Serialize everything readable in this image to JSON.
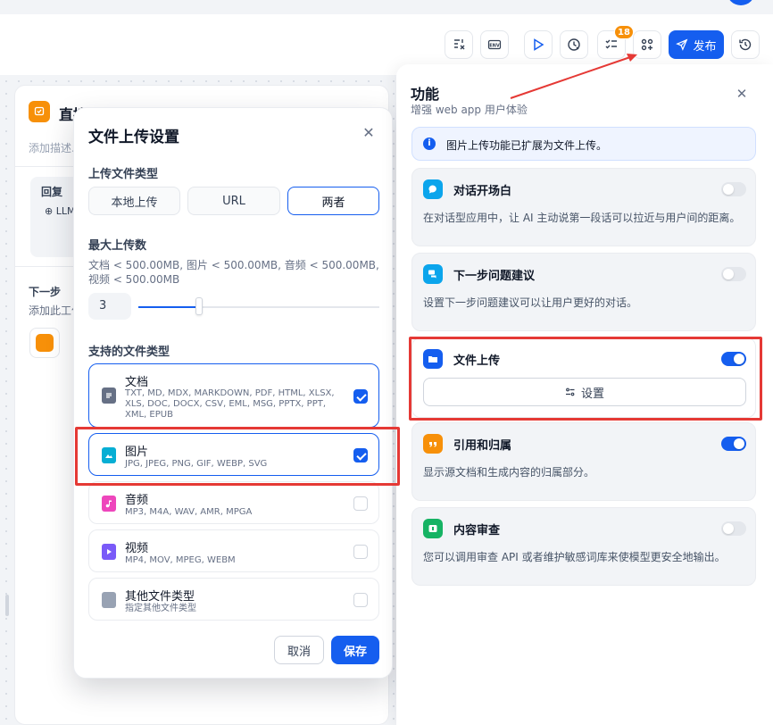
{
  "toolbar": {
    "badge_count": "18",
    "publish_label": "发布",
    "icons": [
      "checklist-x-icon",
      "env-icon",
      "play-icon",
      "history-run-icon",
      "checklist-icon",
      "features-icon",
      "send-icon",
      "history-icon"
    ]
  },
  "background_panel": {
    "title": "直接回复",
    "description": "添加描述...",
    "reply_label": "回复",
    "llm_label": "LLM",
    "next_label": "下一步",
    "next_description": "添加此工作流程中的下一个块"
  },
  "modal": {
    "title": "文件上传设置",
    "upload_type_label": "上传文件类型",
    "upload_types": [
      "本地上传",
      "URL",
      "两者"
    ],
    "selected_upload_type": "两者",
    "max_upload_label": "最大上传数",
    "size_hint": "文档 < 500.00MB, 图片 < 500.00MB, 音频 < 500.00MB, 视频 < 500.00MB",
    "max_upload_value": "3",
    "max_upload_fraction": 0.25,
    "supported_types_label": "支持的文件类型",
    "file_types": [
      {
        "name": "文档",
        "extensions": "TXT, MD, MDX, MARKDOWN, PDF, HTML, XLSX, XLS, DOC, DOCX, CSV, EML, MSG, PPTX, PPT, XML, EPUB",
        "checked": true,
        "color": "#667085"
      },
      {
        "name": "图片",
        "extensions": "JPG, JPEG, PNG, GIF, WEBP, SVG",
        "checked": true,
        "color": "#06aed4"
      },
      {
        "name": "音频",
        "extensions": "MP3, M4A, WAV, AMR, MPGA",
        "checked": false,
        "color": "#ee46bc"
      },
      {
        "name": "视频",
        "extensions": "MP4, MOV, MPEG, WEBM",
        "checked": false,
        "color": "#7a5af8"
      },
      {
        "name": "其他文件类型",
        "extensions": "指定其他文件类型",
        "checked": false,
        "color": "#98a2b3"
      }
    ],
    "cancel_label": "取消",
    "save_label": "保存"
  },
  "features_panel": {
    "title": "功能",
    "subtitle": "增强 web app 用户体验",
    "info_text": "图片上传功能已扩展为文件上传。",
    "features": [
      {
        "name": "对话开场白",
        "description": "在对话型应用中，让 AI 主动说第一段话可以拉近与用户间的距离。",
        "enabled": false,
        "color": "#0ba5ec"
      },
      {
        "name": "下一步问题建议",
        "description": "设置下一步问题建议可以让用户更好的对话。",
        "enabled": false,
        "color": "#0ba5ec"
      },
      {
        "name": "文件上传",
        "description": "",
        "enabled": true,
        "color": "#155eef",
        "settings_label": "设置"
      },
      {
        "name": "引用和归属",
        "description": "显示源文档和生成内容的归属部分。",
        "enabled": true,
        "color": "#f79009"
      },
      {
        "name": "内容审查",
        "description": "您可以调用审查 API 或者维护敏感词库来使模型更安全地输出。",
        "enabled": false,
        "color": "#16b364"
      }
    ]
  },
  "colors": {
    "accent": "#155eef",
    "highlight": "#e53935"
  }
}
